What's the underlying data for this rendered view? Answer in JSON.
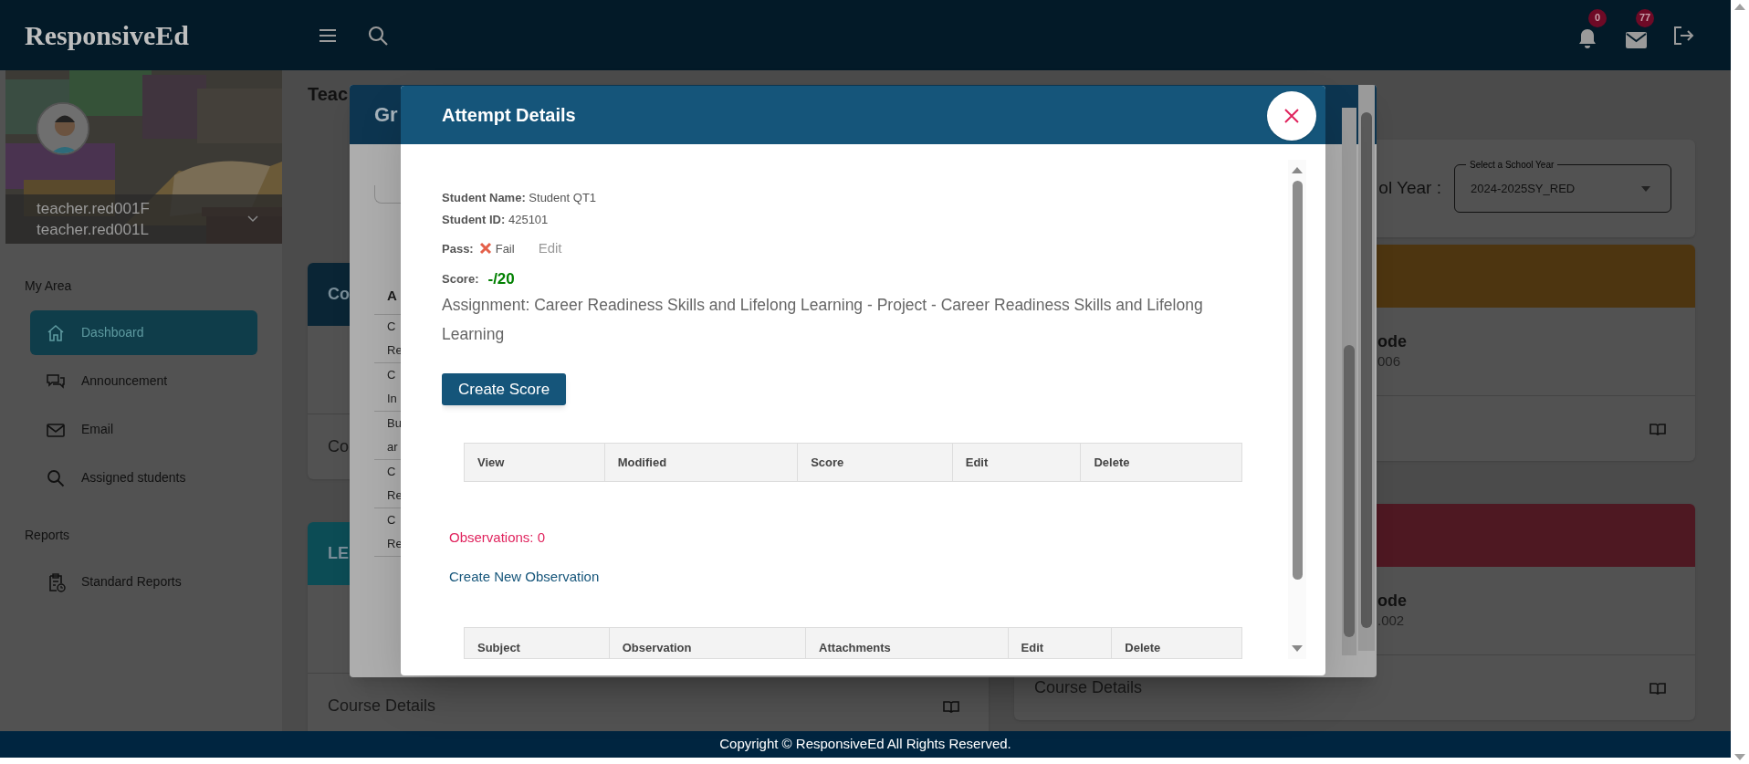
{
  "header": {
    "logo": "ResponsiveEd",
    "notifications": {
      "count": "0"
    },
    "messages": {
      "count": "77"
    }
  },
  "sidebar": {
    "user_lines": [
      "teacher.red001F",
      "teacher.red001L"
    ],
    "sections": [
      {
        "title": "My Area",
        "items": [
          {
            "label": "Dashboard",
            "selected": true
          },
          {
            "label": "Announcement",
            "selected": false
          },
          {
            "label": "Email",
            "selected": false
          },
          {
            "label": "Assigned students",
            "selected": false
          }
        ]
      },
      {
        "title": "Reports",
        "items": [
          {
            "label": "Standard Reports",
            "selected": false
          }
        ]
      }
    ]
  },
  "background": {
    "page_title": "Teac",
    "school_year": {
      "label": "ol Year :",
      "select_label": "Select a School Year",
      "value": "2024-2025SY_RED"
    },
    "left_cards": [
      {
        "header": "Co",
        "color": "#0a2535",
        "footer": "Co"
      },
      {
        "header": "LE",
        "color": "#0c4c55",
        "footer": "Course Details",
        "book_icon": true
      }
    ],
    "right_cards": [
      {
        "color": "#4d3510",
        "code_label": "ode",
        "code": "006",
        "book_icon": true
      },
      {
        "color": "#4e1822",
        "code_label": "ode",
        "code": ".002",
        "footer": "Course Details",
        "book_icon": true
      }
    ]
  },
  "back_dialog": {
    "title": "Gr",
    "column_header": "A",
    "rows": [
      [
        "C",
        "Re"
      ],
      [
        "C",
        "In"
      ],
      [
        "Bu",
        "ar"
      ],
      [
        "C",
        "Re"
      ],
      [
        "C",
        "Re"
      ]
    ]
  },
  "dialog": {
    "title": "Attempt Details",
    "student_name": "**Student Name:** Student QT1",
    "student_id": "**Student ID:** 425101",
    "pass_label": "Pass:",
    "pass_value": "Fail",
    "edit": "Edit",
    "score_label": "Score:",
    "score_value": "-/20",
    "assignment": "Assignment: Career Readiness Skills and Lifelong Learning - Project - Career Readiness Skills and Lifelong Learning",
    "create_button": "Create Score",
    "score_columns": [
      "View",
      "Modified",
      "Score",
      "Edit",
      "Delete"
    ],
    "observations": "Observations: 0",
    "create_observation": "Create New Observation",
    "observation_columns": [
      "Subject",
      "Observation",
      "Attachments",
      "Edit",
      "Delete"
    ]
  },
  "footer": "Copyright © ResponsiveEd All Rights Reserved."
}
